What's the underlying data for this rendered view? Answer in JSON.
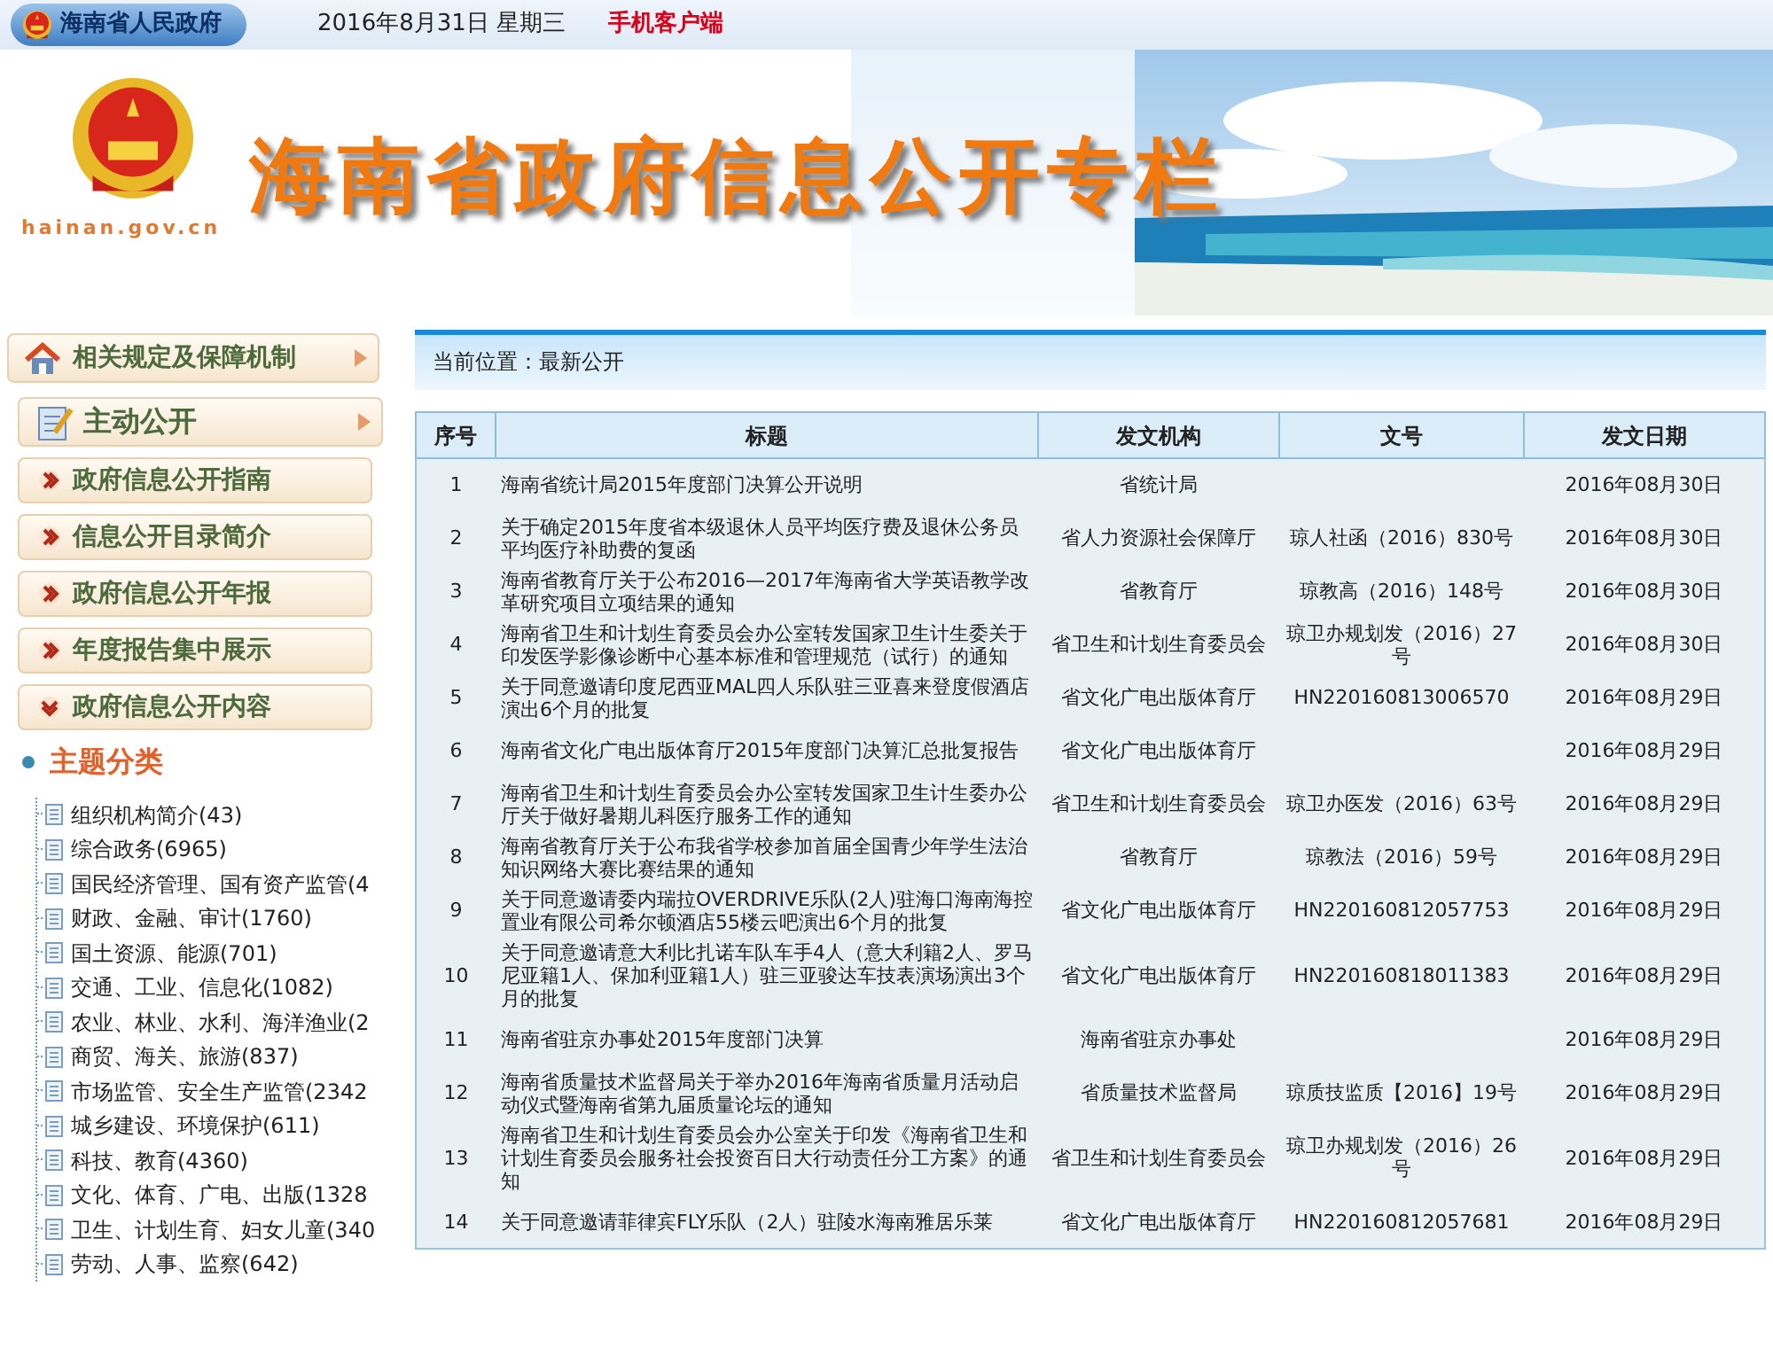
{
  "top_bar": {
    "site_name": "海南省人民政府",
    "date": "2016年8月31日 星期三",
    "mobile_link": "手机客户端"
  },
  "banner": {
    "title": "海南省政府信息公开专栏",
    "domain": "hainan.gov.cn"
  },
  "sidebar": {
    "rules_link": "相关规定及保障机制",
    "section_title": "主动公开",
    "items": [
      {
        "label": "政府信息公开指南",
        "expanded": false
      },
      {
        "label": "信息公开目录简介",
        "expanded": false
      },
      {
        "label": "政府信息公开年报",
        "expanded": false
      },
      {
        "label": "年度报告集中展示",
        "expanded": false
      },
      {
        "label": "政府信息公开内容",
        "expanded": true
      }
    ],
    "topic_header": "主题分类",
    "topics": [
      "组织机构简介(43)",
      "综合政务(6965)",
      "国民经济管理、国有资产监管(4",
      "财政、金融、审计(1760)",
      "国土资源、能源(701)",
      "交通、工业、信息化(1082)",
      "农业、林业、水利、海洋渔业(2",
      "商贸、海关、旅游(837)",
      "市场监管、安全生产监管(2342",
      "城乡建设、环境保护(611)",
      "科技、教育(4360)",
      "文化、体育、广电、出版(1328",
      "卫生、计划生育、妇女儿童(340",
      "劳动、人事、监察(642)"
    ]
  },
  "breadcrumb": "当前位置：最新公开",
  "table": {
    "columns": [
      "序号",
      "标题",
      "发文机构",
      "文号",
      "发文日期"
    ],
    "rows": [
      [
        "1",
        "海南省统计局2015年度部门决算公开说明",
        "省统计局",
        "",
        "2016年08月30日"
      ],
      [
        "2",
        "关于确定2015年度省本级退休人员平均医疗费及退休公务员平均医疗补助费的复函",
        "省人力资源社会保障厅",
        "琼人社函（2016）830号",
        "2016年08月30日"
      ],
      [
        "3",
        "海南省教育厅关于公布2016—2017年海南省大学英语教学改革研究项目立项结果的通知",
        "省教育厅",
        "琼教高（2016）148号",
        "2016年08月30日"
      ],
      [
        "4",
        "海南省卫生和计划生育委员会办公室转发国家卫生计生委关于印发医学影像诊断中心基本标准和管理规范（试行）的通知",
        "省卫生和计划生育委员会",
        "琼卫办规划发（2016）27号",
        "2016年08月30日"
      ],
      [
        "5",
        "关于同意邀请印度尼西亚MAL四人乐队驻三亚喜来登度假酒店演出6个月的批复",
        "省文化广电出版体育厅",
        "HN220160813006570",
        "2016年08月29日"
      ],
      [
        "6",
        "海南省文化广电出版体育厅2015年度部门决算汇总批复报告",
        "省文化广电出版体育厅",
        "",
        "2016年08月29日"
      ],
      [
        "7",
        "海南省卫生和计划生育委员会办公室转发国家卫生计生委办公厅关于做好暑期儿科医疗服务工作的通知",
        "省卫生和计划生育委员会",
        "琼卫办医发（2016）63号",
        "2016年08月29日"
      ],
      [
        "8",
        "海南省教育厅关于公布我省学校参加首届全国青少年学生法治知识网络大赛比赛结果的通知",
        "省教育厅",
        "琼教法（2016）59号",
        "2016年08月29日"
      ],
      [
        "9",
        "关于同意邀请委内瑞拉OVERDRIVE乐队(2人)驻海口海南海控置业有限公司希尔顿酒店55楼云吧演出6个月的批复",
        "省文化广电出版体育厅",
        "HN220160812057753",
        "2016年08月29日"
      ],
      [
        "10",
        "关于同意邀请意大利比扎诺车队车手4人（意大利籍2人、罗马尼亚籍1人、保加利亚籍1人）驻三亚骏达车技表演场演出3个月的批复",
        "省文化广电出版体育厅",
        "HN220160818011383",
        "2016年08月29日"
      ],
      [
        "11",
        "海南省驻京办事处2015年度部门决算",
        "海南省驻京办事处",
        "",
        "2016年08月29日"
      ],
      [
        "12",
        "海南省质量技术监督局关于举办2016年海南省质量月活动启动仪式暨海南省第九届质量论坛的通知",
        "省质量技术监督局",
        "琼质技监质【2016】19号",
        "2016年08月29日"
      ],
      [
        "13",
        "海南省卫生和计划生育委员会办公室关于印发《海南省卫生和计划生育委员会服务社会投资百日大行动责任分工方案》的通知",
        "省卫生和计划生育委员会",
        "琼卫办规划发（2016）26号",
        "2016年08月29日"
      ],
      [
        "14",
        "关于同意邀请菲律宾FLY乐队（2人）驻陵水海南雅居乐莱",
        "省文化广电出版体育厅",
        "HN220160812057681",
        "2016年08月29日"
      ]
    ]
  }
}
